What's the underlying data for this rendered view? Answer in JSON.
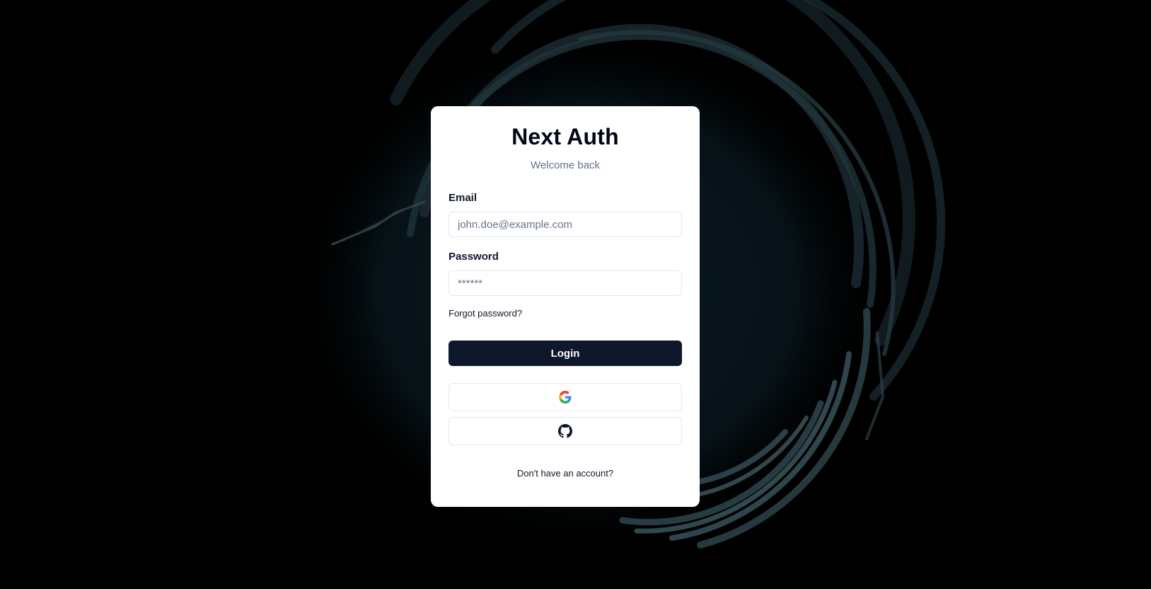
{
  "app": {
    "title": "Next Auth",
    "subtitle": "Welcome back"
  },
  "form": {
    "email": {
      "label": "Email",
      "placeholder": "john.doe@example.com",
      "value": ""
    },
    "password": {
      "label": "Password",
      "placeholder": "******",
      "value": ""
    },
    "forgot_label": "Forgot password?",
    "login_label": "Login"
  },
  "social": [
    {
      "provider": "google",
      "icon": "google-icon"
    },
    {
      "provider": "github",
      "icon": "github-icon"
    }
  ],
  "footer": {
    "signup_label": "Don't have an account?"
  },
  "colors": {
    "page_background": "#000000",
    "card_background": "#ffffff",
    "primary_button": "#0f172a",
    "muted_text": "#64748b",
    "border": "#e2e8f0",
    "swirl_tint": "#2f4a52"
  }
}
